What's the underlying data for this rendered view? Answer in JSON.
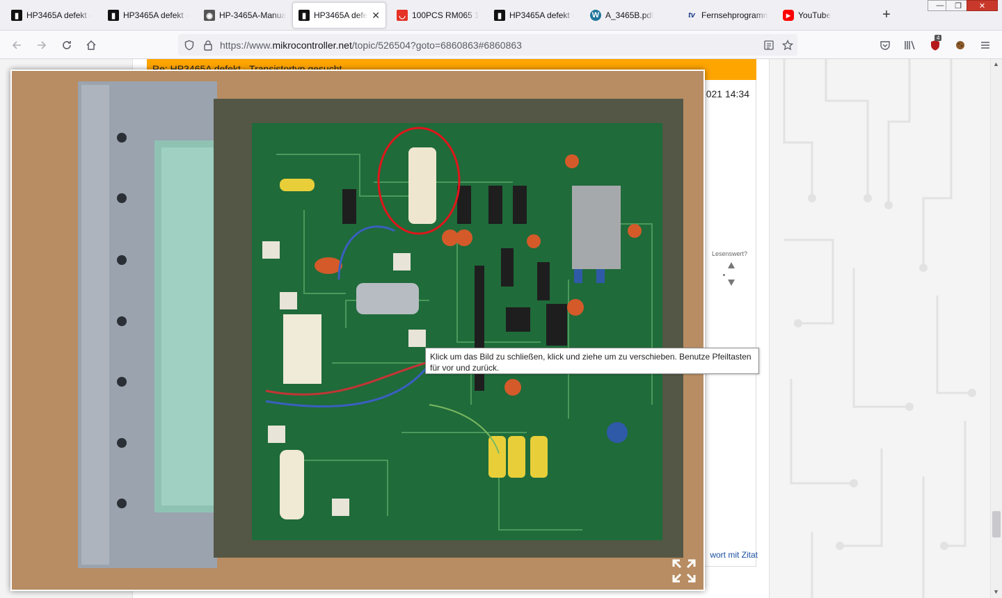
{
  "tabs": [
    {
      "label": "HP3465A defekt -",
      "icon": "mc-icon",
      "active": false
    },
    {
      "label": "HP3465A defekt -",
      "icon": "mc-icon",
      "active": false
    },
    {
      "label": "HP-3465A-Manua",
      "icon": "doc-icon",
      "active": false
    },
    {
      "label": "HP3465A defekt",
      "icon": "mc-icon",
      "active": true
    },
    {
      "label": "100PCS RM065 100",
      "icon": "aliexpress-icon",
      "active": false
    },
    {
      "label": "HP3465A defekt -",
      "icon": "mc-icon",
      "active": false
    },
    {
      "label": "A_3465B.pdf",
      "icon": "wordpress-icon",
      "active": false
    },
    {
      "label": "Fernsehprogramm",
      "icon": "tv-icon",
      "active": false
    },
    {
      "label": "YouTube",
      "icon": "youtube-icon",
      "active": false
    }
  ],
  "tab_close_glyph": "✕",
  "new_tab_glyph": "+",
  "window": {
    "minimize": "—",
    "restore": "❐",
    "close": "✕"
  },
  "urlbar": {
    "prefix": "https://www.",
    "host": "mikrocontroller.net",
    "path": "/topic/526504?goto=6860863#6860863"
  },
  "toolbar_badge": "4",
  "post": {
    "header": "Re: HP3465A defekt - Transistortyp gesucht",
    "date": "021 14:34",
    "rating_label": "Lesenswert?",
    "reply_link": "wort mit Zitat"
  },
  "tooltip": {
    "line1": "Klick um das Bild zu schließen, klick und ziehe um zu verschieben. Benutze Pfeiltasten",
    "line2": "für vor und zurück."
  },
  "colors": {
    "post_header": "#ffa500",
    "pcb_green": "#1f6b3a",
    "annotation_circle": "#e0161b",
    "tab_active_bg": "#ffffff",
    "link": "#1a4fa0"
  }
}
